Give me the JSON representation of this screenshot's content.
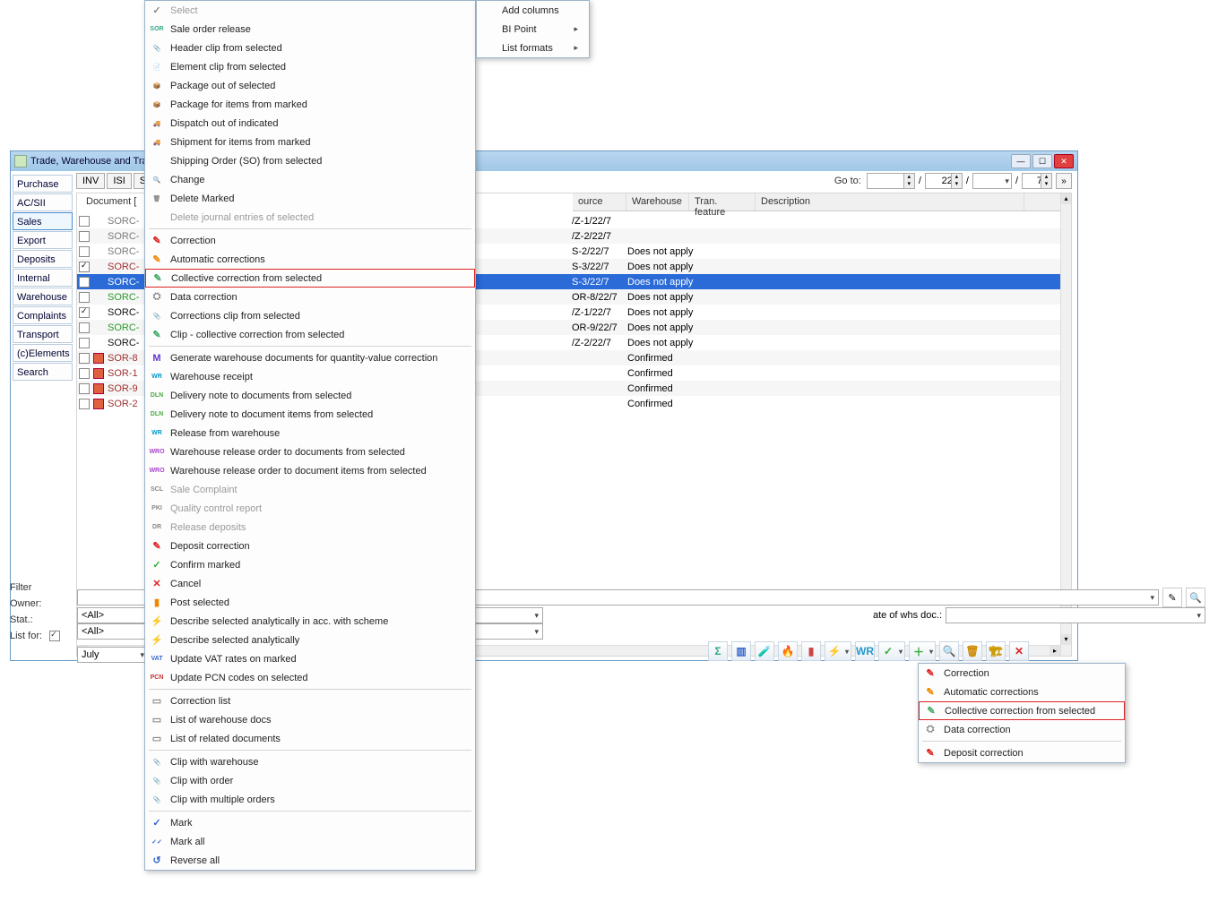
{
  "window": {
    "title": "Trade, Warehouse and Trans..."
  },
  "nav": {
    "items": [
      "Purchase",
      "AC/SII",
      "Sales",
      "Export",
      "Deposits",
      "Internal",
      "Warehouse",
      "Complaints",
      "Transport",
      "(c)Elements",
      "Search"
    ],
    "selected": "Sales"
  },
  "tabs": {
    "items": [
      "INV",
      "ISI",
      "SO"
    ]
  },
  "goto": {
    "label": "Go to:",
    "field1": "",
    "slash": "/",
    "field2": "22",
    "field3": "",
    "field4": "7"
  },
  "grid": {
    "docLabel": "Document [",
    "headers": [
      "ource",
      "Warehouse",
      "Tran. feature",
      "Description"
    ],
    "headerWidths": [
      60,
      70,
      74,
      300
    ],
    "rows": [
      {
        "chk": false,
        "icon": "none",
        "doc": "SORC-",
        "src": "/Z-1/22/7",
        "wh": "",
        "color": "#7a7a7a"
      },
      {
        "chk": false,
        "icon": "none",
        "doc": "SORC-",
        "src": "/Z-2/22/7",
        "wh": "",
        "color": "#7a7a7a",
        "stripe": true
      },
      {
        "chk": false,
        "icon": "none",
        "doc": "SORC-",
        "src": "S-2/22/7",
        "wh": "Does not apply",
        "color": "#7a7a7a"
      },
      {
        "chk": true,
        "icon": "none",
        "doc": "SORC-",
        "src": "S-3/22/7",
        "wh": "Does not apply",
        "color": "#a03030",
        "stripe": true
      },
      {
        "chk": false,
        "icon": "none",
        "doc": "SORC-",
        "src": "S-3/22/7",
        "wh": "Does not apply",
        "color": "#fff",
        "sel": true
      },
      {
        "chk": false,
        "icon": "none",
        "doc": "SORC-",
        "src": "OR-8/22/7",
        "wh": "Does not apply",
        "color": "#2a9a2a",
        "stripe": true
      },
      {
        "chk": true,
        "icon": "none",
        "doc": "SORC-",
        "src": "/Z-1/22/7",
        "wh": "Does not apply",
        "color": "#111"
      },
      {
        "chk": false,
        "icon": "none",
        "doc": "SORC-",
        "src": "OR-9/22/7",
        "wh": "Does not apply",
        "color": "#2a9a2a",
        "stripe": true
      },
      {
        "chk": false,
        "icon": "none",
        "doc": "SORC-",
        "src": "/Z-2/22/7",
        "wh": "Does not apply",
        "color": "#111"
      },
      {
        "chk": false,
        "icon": "red",
        "doc": "SOR-8",
        "src": "",
        "wh": "Confirmed",
        "color": "#a03030",
        "stripe": true
      },
      {
        "chk": false,
        "icon": "red",
        "doc": "SOR-1",
        "src": "",
        "wh": "Confirmed",
        "color": "#a03030"
      },
      {
        "chk": false,
        "icon": "red",
        "doc": "SOR-9",
        "src": "",
        "wh": "Confirmed",
        "color": "#a03030",
        "stripe": true
      },
      {
        "chk": false,
        "icon": "red",
        "doc": "SOR-2",
        "src": "",
        "wh": "Confirmed",
        "color": "#a03030"
      }
    ]
  },
  "filters": {
    "filterLabel": "Filter",
    "ownerLabel": "Owner:",
    "ownerValue": "<All>",
    "statLabel": "Stat.:",
    "statValue": "<All>",
    "listForLabel": "List for:",
    "listForValue": "July",
    "stateOfWhsLabel": "ate of whs doc.:"
  },
  "context_menu_main": {
    "items": [
      {
        "t": "Select",
        "disabled": true,
        "icon": "✓"
      },
      {
        "t": "Sale order release",
        "icon": "SOR",
        "ic": "#3a8"
      },
      {
        "t": "Header clip from selected",
        "icon": "📎"
      },
      {
        "t": "Element clip from selected",
        "icon": "📄"
      },
      {
        "t": "Package out of selected",
        "icon": "📦",
        "ic": "#c60"
      },
      {
        "t": "Package for items from marked",
        "icon": "📦",
        "ic": "#c60"
      },
      {
        "t": "Dispatch out of indicated",
        "icon": "🚚",
        "ic": "#c60"
      },
      {
        "t": "Shipment for items from marked",
        "icon": "🚚",
        "ic": "#c60"
      },
      {
        "t": "Shipping Order (SO) from selected",
        "icon": ""
      },
      {
        "t": "Change",
        "icon": "🔍"
      },
      {
        "t": "Delete Marked",
        "icon": "🗑"
      },
      {
        "t": "Delete journal entries of selected",
        "disabled": true,
        "icon": ""
      },
      {
        "sep": true
      },
      {
        "t": "Correction",
        "icon": "✎",
        "ic": "#d22"
      },
      {
        "t": "Automatic corrections",
        "icon": "✎",
        "ic": "#e80"
      },
      {
        "t": "Collective correction from selected",
        "icon": "✎",
        "ic": "#4a6",
        "hl": true
      },
      {
        "t": "Data correction",
        "icon": "⛭"
      },
      {
        "t": "Corrections clip from selected",
        "icon": "📎"
      },
      {
        "t": "Clip - collective correction from selected",
        "icon": "✎",
        "ic": "#4a6"
      },
      {
        "sep": true
      },
      {
        "t": "Generate warehouse documents for quantity-value correction",
        "icon": "M",
        "ic": "#63c"
      },
      {
        "t": "Warehouse receipt",
        "icon": "WR",
        "ic": "#09c"
      },
      {
        "t": "Delivery note to documents from selected",
        "icon": "DLN",
        "ic": "#4a4"
      },
      {
        "t": "Delivery note to document items from selected",
        "icon": "DLN",
        "ic": "#4a4"
      },
      {
        "t": "Release from warehouse",
        "icon": "WR",
        "ic": "#09c"
      },
      {
        "t": "Warehouse release order to documents from selected",
        "icon": "WRO",
        "ic": "#a4c"
      },
      {
        "t": "Warehouse release order to document items from selected",
        "icon": "WRO",
        "ic": "#a4c"
      },
      {
        "t": "Sale Complaint",
        "disabled": true,
        "icon": "SCL"
      },
      {
        "t": "Quality control report",
        "disabled": true,
        "icon": "PKI"
      },
      {
        "t": "Release deposits",
        "disabled": true,
        "icon": "DR"
      },
      {
        "t": "Deposit correction",
        "icon": "✎",
        "ic": "#d22"
      },
      {
        "t": "Confirm marked",
        "icon": "✓",
        "ic": "#3a3"
      },
      {
        "t": "Cancel",
        "icon": "✕",
        "ic": "#d22"
      },
      {
        "t": "Post selected",
        "icon": "▮",
        "ic": "#e80"
      },
      {
        "t": "Describe selected analytically in acc. with scheme",
        "icon": "⚡",
        "ic": "#e90"
      },
      {
        "t": "Describe selected analytically",
        "icon": "⚡",
        "ic": "#e90"
      },
      {
        "t": "Update VAT rates on marked",
        "icon": "VAT",
        "ic": "#36c"
      },
      {
        "t": "Update PCN codes on selected",
        "icon": "PCN",
        "ic": "#c33"
      },
      {
        "sep": true
      },
      {
        "t": "Correction list",
        "icon": "▭"
      },
      {
        "t": "List of warehouse docs",
        "icon": "▭"
      },
      {
        "t": "List of related documents",
        "icon": "▭"
      },
      {
        "sep": true
      },
      {
        "t": "Clip with warehouse",
        "icon": "📎",
        "ic": "#3a7"
      },
      {
        "t": "Clip with order",
        "icon": "📎",
        "ic": "#3a7"
      },
      {
        "t": "Clip with multiple orders",
        "icon": "📎",
        "ic": "#3a7"
      },
      {
        "sep": true
      },
      {
        "t": "Mark",
        "icon": "✓",
        "ic": "#36c"
      },
      {
        "t": "Mark all",
        "icon": "✓✓",
        "ic": "#36c"
      },
      {
        "t": "Reverse all",
        "icon": "↺",
        "ic": "#36c"
      }
    ]
  },
  "top_submenu": {
    "items": [
      {
        "t": "Add columns"
      },
      {
        "t": "BI Point",
        "sub": true
      },
      {
        "t": "List formats",
        "sub": true
      }
    ]
  },
  "dropdown_corr": {
    "items": [
      {
        "t": "Correction",
        "icon": "✎",
        "ic": "#d22"
      },
      {
        "t": "Automatic corrections",
        "icon": "✎",
        "ic": "#e80"
      },
      {
        "t": "Collective correction from selected",
        "icon": "✎",
        "ic": "#4a6",
        "hl": true
      },
      {
        "t": "Data correction",
        "icon": "⛭"
      },
      {
        "sep": true
      },
      {
        "t": "Deposit correction",
        "icon": "✎",
        "ic": "#d22"
      }
    ]
  },
  "toolbar": {
    "icons": [
      "Σ",
      "▥",
      "🧪",
      "🔥",
      "▮",
      "⚡",
      "WR",
      "✓",
      "＋",
      "🔍",
      "🗑",
      "🏗",
      "✕"
    ],
    "colors": [
      "#3a8",
      "#36c",
      "#e90",
      "#d50",
      "#c44",
      "#e90",
      "#29c",
      "#3a3",
      "#3a3",
      "#36c",
      "#c80",
      "#c90",
      "#d22"
    ]
  }
}
